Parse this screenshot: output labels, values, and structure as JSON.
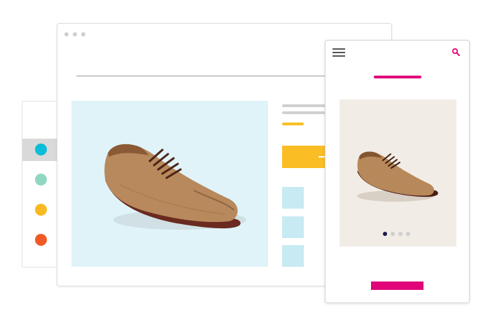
{
  "colors": {
    "swatches": [
      "#0dbcd8",
      "#8fd6c3",
      "#f9b920",
      "#f15a24"
    ],
    "swatch_active_bg": "#d9d9d9",
    "desktop_hero_bg": "#e0f3f9",
    "desktop_cta": "#fbbd24",
    "thumbnail": "#c8eaf3",
    "mobile_accent": "#e0067a",
    "mobile_hero_bg": "#f2ece6",
    "carousel_active": "#1b1b4d"
  },
  "swatch_panel": {
    "active_index": 0
  },
  "icons": {
    "menu": "hamburger-menu-icon",
    "search": "search-icon",
    "window_controls": "window-control-dots-icon"
  },
  "carousel": {
    "total": 4,
    "active_index": 0
  }
}
